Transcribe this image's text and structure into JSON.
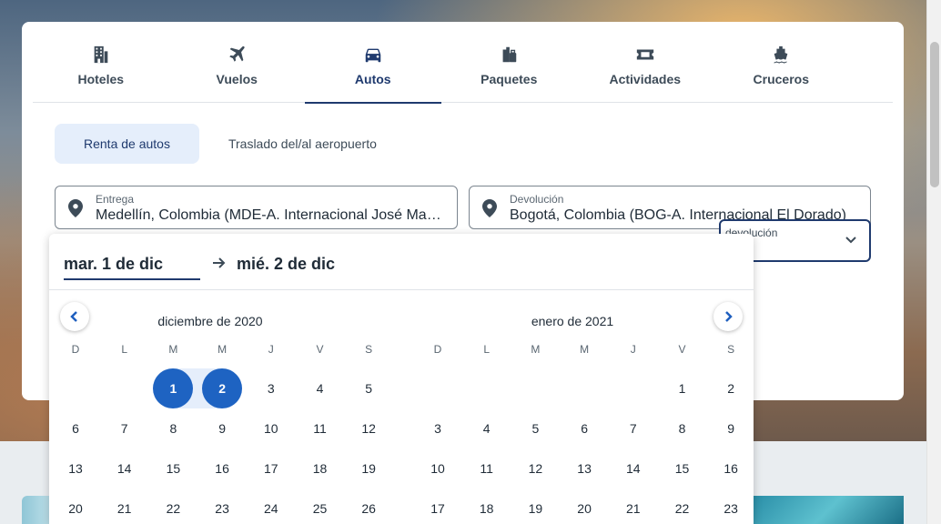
{
  "tabs": [
    {
      "label": "Hoteles",
      "icon": "building-icon",
      "active": false
    },
    {
      "label": "Vuelos",
      "icon": "plane-icon",
      "active": false
    },
    {
      "label": "Autos",
      "icon": "car-icon",
      "active": true
    },
    {
      "label": "Paquetes",
      "icon": "luggage-icon",
      "active": false
    },
    {
      "label": "Actividades",
      "icon": "ticket-icon",
      "active": false
    },
    {
      "label": "Cruceros",
      "icon": "ship-icon",
      "active": false
    }
  ],
  "subtabs": [
    {
      "label": "Renta de autos",
      "active": true
    },
    {
      "label": "Traslado del/al aeropuerto",
      "active": false
    }
  ],
  "pickup": {
    "label": "Entrega",
    "value": "Medellín, Colombia (MDE-A. Internacional José María Córdova)"
  },
  "dropoff": {
    "label": "Devolución",
    "value": "Bogotá, Colombia (BOG-A. Internacional El Dorado)"
  },
  "time_select": {
    "label": "devolución"
  },
  "calendar": {
    "start_date": "mar. 1 de dic",
    "end_date": "mié. 2 de dic",
    "weekdays": [
      "D",
      "L",
      "M",
      "M",
      "J",
      "V",
      "S"
    ],
    "months": [
      {
        "title": "diciembre de 2020",
        "rows": [
          [
            "",
            "",
            "1",
            "2",
            "3",
            "4",
            "5"
          ],
          [
            "6",
            "7",
            "8",
            "9",
            "10",
            "11",
            "12"
          ],
          [
            "13",
            "14",
            "15",
            "16",
            "17",
            "18",
            "19"
          ],
          [
            "20",
            "21",
            "22",
            "23",
            "24",
            "25",
            "26"
          ]
        ],
        "selected": [
          "1",
          "2"
        ]
      },
      {
        "title": "enero de 2021",
        "rows": [
          [
            "",
            "",
            "",
            "",
            "",
            "1",
            "2"
          ],
          [
            "3",
            "4",
            "5",
            "6",
            "7",
            "8",
            "9"
          ],
          [
            "10",
            "11",
            "12",
            "13",
            "14",
            "15",
            "16"
          ],
          [
            "17",
            "18",
            "19",
            "20",
            "21",
            "22",
            "23"
          ]
        ],
        "selected": []
      }
    ]
  },
  "colors": {
    "accent": "#1e63c2",
    "brand_dark": "#1f3a6e",
    "range": "#e5eefb"
  }
}
